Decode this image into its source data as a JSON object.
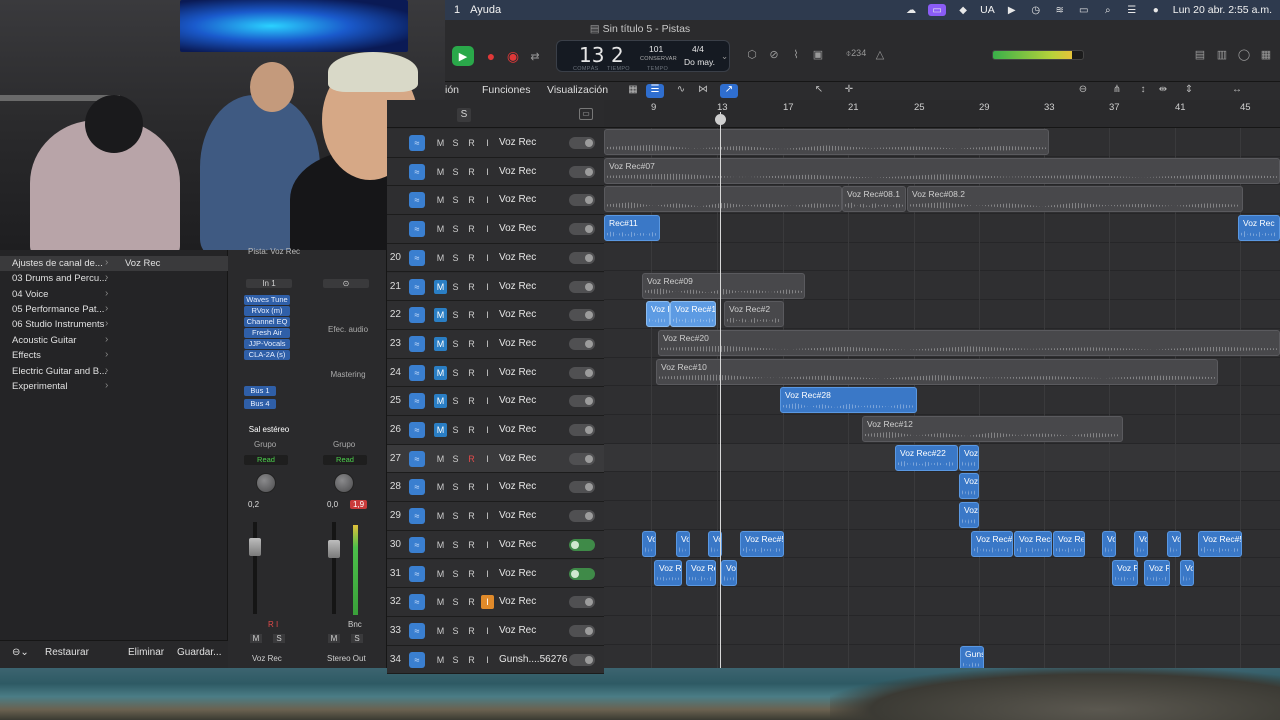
{
  "menubar": {
    "items": [
      "1",
      "Ayuda"
    ],
    "right": {
      "lang": "UA",
      "datetime": "Lun 20 abr.  2:55 a.m."
    }
  },
  "window": {
    "title": "Sin título 5 - Pistas"
  },
  "lcd": {
    "bar": "13",
    "beat": "2",
    "bar_label": "COMPÁS",
    "beat_label": "TIEMPO",
    "tempo": "101",
    "tempo_sub": "CONSERVAR",
    "tempo_label": "TEMPO",
    "signature": "4/4",
    "key": "Do may."
  },
  "controlbar": {
    "count_in": "⌽234",
    "meter_level": 0.88
  },
  "toolbar": {
    "menu_edit": "ión",
    "menu_functions": "Funciones",
    "menu_view": "Visualización"
  },
  "ruler": {
    "marks": [
      "9",
      "13",
      "17",
      "21",
      "25",
      "29",
      "33",
      "37",
      "41",
      "45"
    ]
  },
  "trackhead": {
    "s_label": "S"
  },
  "tracks": [
    {
      "num": "",
      "name": "Voz Rec",
      "m": "M",
      "s": "S",
      "r": "R",
      "i": "I"
    },
    {
      "num": "",
      "name": "Voz Rec",
      "m": "M",
      "s": "S",
      "r": "R",
      "i": "I"
    },
    {
      "num": "",
      "name": "Voz Rec",
      "m": "M",
      "s": "S",
      "r": "R",
      "i": "I"
    },
    {
      "num": "",
      "name": "Voz Rec",
      "m": "M",
      "s": "S",
      "r": "R",
      "i": "I"
    },
    {
      "num": "20",
      "name": "Voz Rec",
      "m": "M",
      "s": "S",
      "r": "R",
      "i": "I"
    },
    {
      "num": "21",
      "name": "Voz Rec",
      "m": "M",
      "s": "S",
      "r": "R",
      "i": "I"
    },
    {
      "num": "22",
      "name": "Voz Rec",
      "m": "M",
      "s": "S",
      "r": "R",
      "i": "I"
    },
    {
      "num": "23",
      "name": "Voz Rec",
      "m": "M",
      "s": "S",
      "r": "R",
      "i": "I"
    },
    {
      "num": "24",
      "name": "Voz Rec",
      "m": "M",
      "s": "S",
      "r": "R",
      "i": "I"
    },
    {
      "num": "25",
      "name": "Voz Rec",
      "m": "M",
      "s": "S",
      "r": "R",
      "i": "I"
    },
    {
      "num": "26",
      "name": "Voz Rec",
      "m": "M",
      "s": "S",
      "r": "R",
      "i": "I"
    },
    {
      "num": "27",
      "name": "Voz Rec",
      "m": "M",
      "s": "S",
      "r": "R",
      "i": "I"
    },
    {
      "num": "28",
      "name": "Voz Rec",
      "m": "M",
      "s": "S",
      "r": "R",
      "i": "I"
    },
    {
      "num": "29",
      "name": "Voz Rec",
      "m": "M",
      "s": "S",
      "r": "R",
      "i": "I"
    },
    {
      "num": "30",
      "name": "Voz Rec",
      "m": "M",
      "s": "S",
      "r": "R",
      "i": "I"
    },
    {
      "num": "31",
      "name": "Voz Rec",
      "m": "M",
      "s": "S",
      "r": "R",
      "i": "I"
    },
    {
      "num": "32",
      "name": "Voz Rec",
      "m": "M",
      "s": "S",
      "r": "R",
      "i": "I"
    },
    {
      "num": "33",
      "name": "Voz Rec",
      "m": "M",
      "s": "S",
      "r": "R",
      "i": "I"
    },
    {
      "num": "34",
      "name": "Gunsh....56276",
      "m": "M",
      "s": "S",
      "r": "R",
      "i": "I"
    }
  ],
  "regions": [
    "Voz Rec#07",
    "Voz Rec#08.1",
    "Voz Rec#08.2",
    "Rec#11",
    "Voz Rec",
    "Voz Rec#09",
    "Voz R",
    "Voz Rec#1",
    "Voz Rec#2",
    "Voz Rec#20",
    "Voz Rec#10",
    "Voz Rec#28",
    "Voz Rec#12",
    "Voz Rec#22",
    "Voz",
    "Voz",
    "Voz",
    "Vo",
    "Vo",
    "Vo",
    "Voz Rec#5",
    "Voz Rec#2",
    "Voz Rec#",
    "Voz Rec",
    "Vo",
    "Vo",
    "Vo",
    "Voz Rec#5",
    "Voz Re",
    "Voz Re",
    "Vo",
    "Voz R",
    "Voz R",
    "Vo",
    "Guns"
  ],
  "library": {
    "items": [
      "Ajustes de canal de...",
      "03 Drums and Percu...",
      "04 Voice",
      "05 Performance Pat...",
      "06 Studio Instruments",
      "Acoustic Guitar",
      "Effects",
      "Electric Guitar and B...",
      "Experimental"
    ],
    "selected_patch": "Voz Rec",
    "buttons": {
      "restore": "Restaurar",
      "delete": "Eliminar",
      "save": "Guardar..."
    }
  },
  "mixer": {
    "track_label": "Pista:  Voz Rec",
    "input": "In 1",
    "plugins": [
      "Waves Tune",
      "RVox (m)",
      "Channel EQ",
      "Fresh Air",
      "JJP-Vocals",
      "CLA-2A (s)"
    ],
    "sends": [
      "Bus 1",
      "Bus 4"
    ],
    "output": "Sal estéreo",
    "group": "Grupo",
    "automation": "Read",
    "fx_label": "Efec. audio",
    "mastering": "Mastering",
    "ch1": {
      "pan": "0,2",
      "name": "Voz Rec",
      "m": "M",
      "s": "S",
      "ri": "R  I"
    },
    "ch2": {
      "pan": "0,0",
      "peak": "1,9",
      "name": "Stereo Out",
      "m": "M",
      "s": "S",
      "bnc": "Bnc"
    }
  }
}
